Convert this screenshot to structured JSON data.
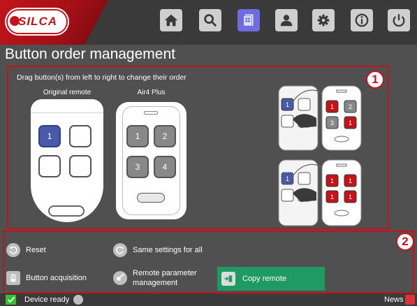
{
  "app": {
    "logo_text": "SILCA"
  },
  "toolbar": {
    "buttons": [
      {
        "name": "home-icon"
      },
      {
        "name": "search-icon"
      },
      {
        "name": "remote-list-icon",
        "active": true
      },
      {
        "name": "user-icon"
      },
      {
        "name": "gear-icon"
      },
      {
        "name": "info-icon"
      },
      {
        "name": "power-icon"
      }
    ]
  },
  "page": {
    "title": "Button order management"
  },
  "panel1": {
    "badge": "1",
    "instruction": "Drag button(s) from left to right to change their order",
    "original_label": "Original remote",
    "air_label": "Air4 Plus",
    "original_buttons": [
      "1",
      "",
      "",
      ""
    ],
    "air_buttons": [
      "1",
      "2",
      "3",
      "4"
    ],
    "illustration": {
      "top_left_button": "1",
      "top_right_buttons": [
        "1",
        "2",
        "3",
        "1"
      ],
      "bottom_left_button": "1",
      "bottom_right_buttons": [
        "1",
        "1",
        "1",
        "1"
      ]
    }
  },
  "panel2": {
    "badge": "2",
    "reset": "Reset",
    "same_settings": "Same settings for all",
    "button_acquisition": "Button acquisition",
    "remote_parameter_line1": "Remote parameter",
    "remote_parameter_line2": "management",
    "copy_remote": "Copy remote"
  },
  "status": {
    "device": "Device ready",
    "news": "News"
  },
  "colors": {
    "accent": "#c3141c",
    "selected": "#4a5aa8",
    "copy": "#1f9a63",
    "topbar": "#3a3a3a",
    "bg": "#505050"
  }
}
